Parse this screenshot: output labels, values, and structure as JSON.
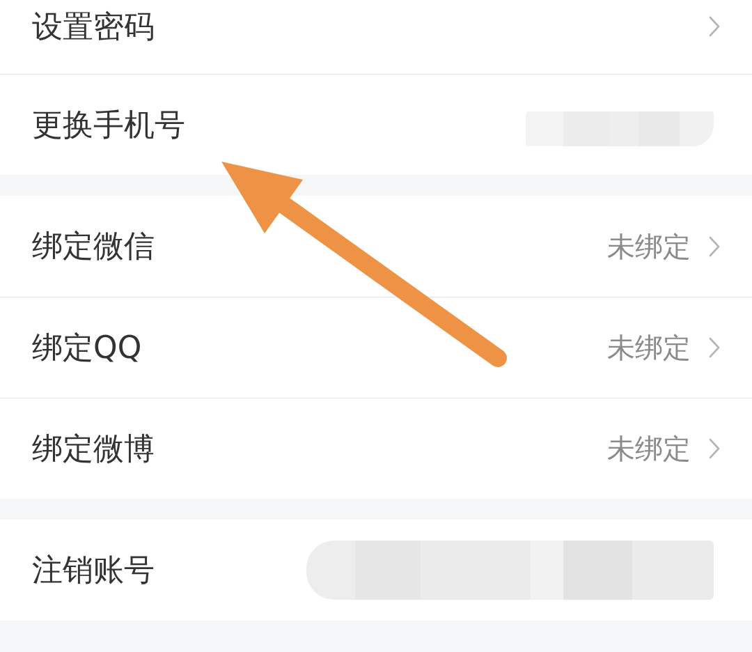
{
  "groups": [
    {
      "items": [
        {
          "label": "设置密码",
          "chevron": true,
          "redacted": false
        },
        {
          "label": "更换手机号",
          "chevron": false,
          "redacted": true
        }
      ]
    },
    {
      "items": [
        {
          "label": "绑定微信",
          "value": "未绑定",
          "chevron": true,
          "redacted": false
        },
        {
          "label": "绑定QQ",
          "value": "未绑定",
          "chevron": true,
          "redacted": false
        },
        {
          "label": "绑定微博",
          "value": "未绑定",
          "chevron": true,
          "redacted": false
        }
      ]
    },
    {
      "items": [
        {
          "label": "注销账号",
          "chevron": false,
          "redacted": true
        }
      ]
    }
  ],
  "annotations": [
    {
      "kind": "arrow"
    }
  ]
}
